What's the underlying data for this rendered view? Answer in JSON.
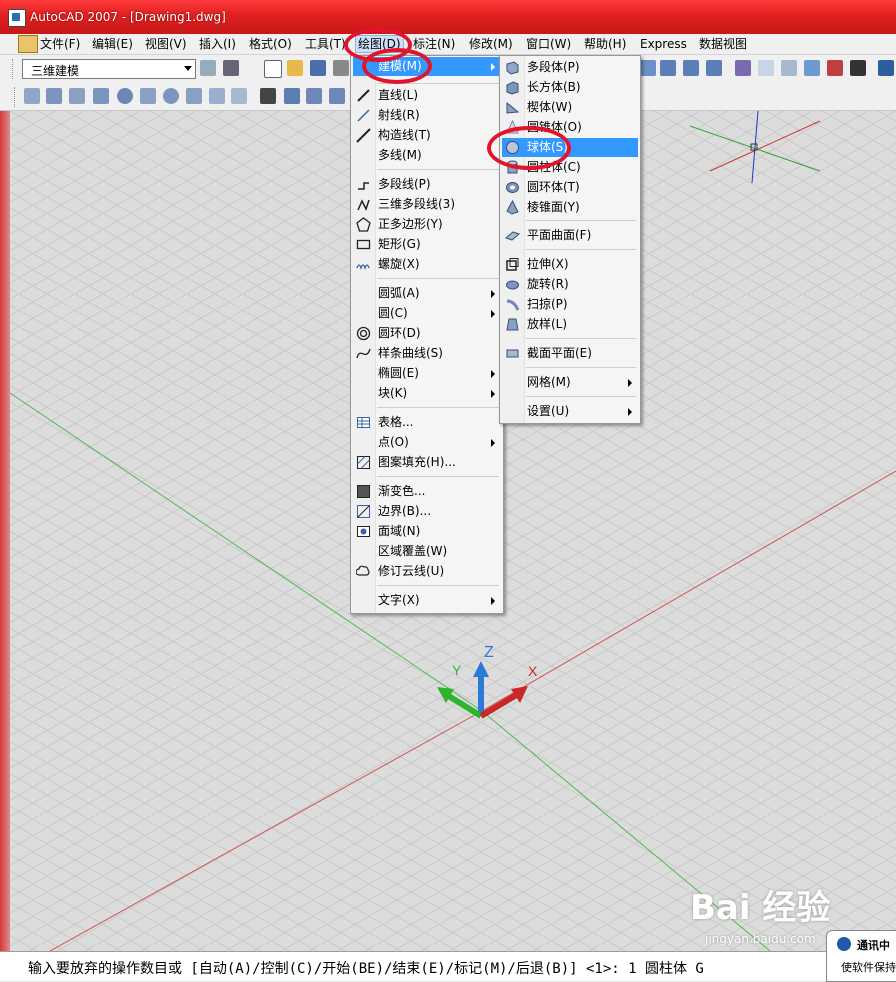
{
  "window": {
    "title": "AutoCAD 2007 - [Drawing1.dwg]"
  },
  "menubar": {
    "items": [
      "文件(F)",
      "编辑(E)",
      "视图(V)",
      "插入(I)",
      "格式(O)",
      "工具(T)",
      "绘图(D)",
      "标注(N)",
      "修改(M)",
      "窗口(W)",
      "帮助(H)",
      "Express",
      "数据视图"
    ]
  },
  "toolbar": {
    "workspace_value": "三维建模"
  },
  "draw_menu": {
    "items": [
      "建模(M)",
      "直线(L)",
      "射线(R)",
      "构造线(T)",
      "多线(M)",
      "多段线(P)",
      "三维多段线(3)",
      "正多边形(Y)",
      "矩形(G)",
      "螺旋(X)",
      "圆弧(A)",
      "圆(C)",
      "圆环(D)",
      "样条曲线(S)",
      "椭圆(E)",
      "块(K)",
      "表格...",
      "点(O)",
      "图案填充(H)...",
      "渐变色...",
      "边界(B)...",
      "面域(N)",
      "区域覆盖(W)",
      "修订云线(U)",
      "文字(X)"
    ]
  },
  "modeling_menu": {
    "items": [
      "多段体(P)",
      "长方体(B)",
      "楔体(W)",
      "圆锥体(O)",
      "球体(S)",
      "圆柱体(C)",
      "圆环体(T)",
      "棱锥面(Y)",
      "平面曲面(F)",
      "拉伸(X)",
      "旋转(R)",
      "扫掠(P)",
      "放样(L)",
      "截面平面(E)",
      "网格(M)",
      "设置(U)"
    ]
  },
  "ucs": {
    "x": "X",
    "y": "Y",
    "z": "Z"
  },
  "command_line": {
    "text": "输入要放弃的操作数目或 [自动(A)/控制(C)/开始(BE)/结束(E)/标记(M)/后退(B)] <1>: 1 圆柱体 G"
  },
  "notification": {
    "title": "通讯中",
    "body": "使软件保持"
  },
  "watermark": {
    "text": "Bai 经验",
    "sub": "jingyan.baidu.com"
  },
  "colors": {
    "title_bar": "#e02020",
    "highlight": "#3399ff",
    "annotation": "#e2142c"
  }
}
